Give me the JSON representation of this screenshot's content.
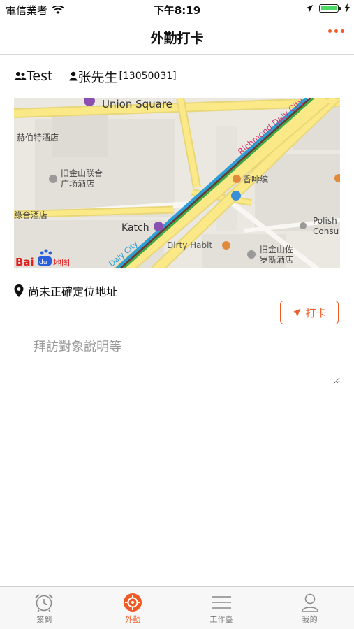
{
  "status_bar": {
    "carrier": "電信業者",
    "time": "下午8:19"
  },
  "nav": {
    "title": "外勤打卡",
    "more_icon": "more-dots-icon"
  },
  "user": {
    "group": "Test",
    "name": "张先生",
    "code": "[13050031]"
  },
  "map": {
    "labels": {
      "union_square": "Union Square",
      "richmond": "Richmond Daly City",
      "daly_city": "Daly City",
      "hotel_1": "赫伯特酒店",
      "hotel_2a": "旧金山联合",
      "hotel_2b": "广场酒店",
      "hotel_3": "綠合酒店",
      "cafe": "香啡缤",
      "katch": "Katch",
      "dirty_habit": "Dirty Habit",
      "polish_a": "Polish",
      "polish_b": "Consu",
      "hotel_4a": "旧金山佐",
      "hotel_4b": "罗斯酒店",
      "logo_text": "Bai",
      "logo_du": "du",
      "logo_map": "地图"
    }
  },
  "location": {
    "text": "尚未正確定位地址"
  },
  "punch_button": {
    "label": "打卡"
  },
  "purpose": {
    "placeholder": "拜訪對象說明等",
    "value": ""
  },
  "tabs": [
    {
      "label": "簽到",
      "icon": "alarm-clock-icon",
      "active": false
    },
    {
      "label": "外勤",
      "icon": "target-icon",
      "active": true
    },
    {
      "label": "工作臺",
      "icon": "menu-lines-icon",
      "active": false
    },
    {
      "label": "我的",
      "icon": "user-icon",
      "active": false
    }
  ],
  "colors": {
    "accent": "#f05a24",
    "battery": "#4cd964",
    "road_yellow": "#fbe887",
    "map_bg": "#ebe8e2"
  }
}
